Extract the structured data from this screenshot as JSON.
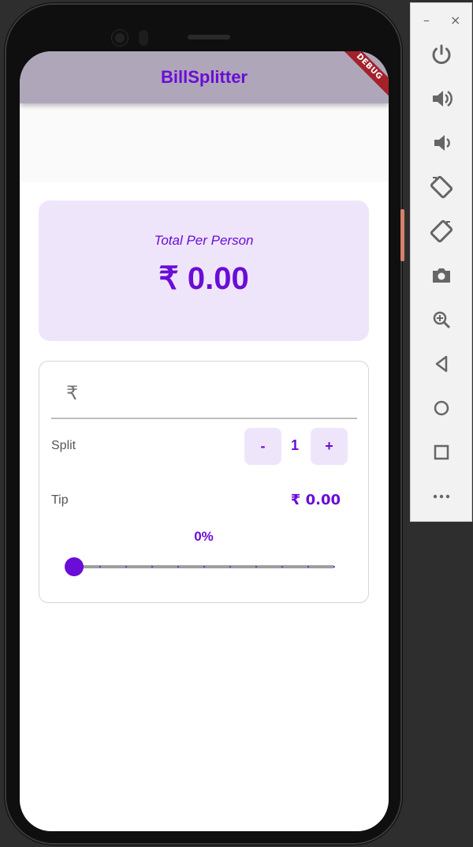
{
  "app": {
    "title": "BillSplitter",
    "debug_banner": "DEBUG"
  },
  "summary": {
    "label": "Total Per Person",
    "amount": "₹ 0.00"
  },
  "bill_input": {
    "prefix": "₹",
    "value": ""
  },
  "split": {
    "label": "Split",
    "decrement_label": "-",
    "count": "1",
    "increment_label": "+"
  },
  "tip": {
    "label": "Tip",
    "amount": "₹ 0.00",
    "percent_label": "0%",
    "percent_value": 0,
    "tick_count": 11
  },
  "emulator_toolbar": {
    "minimize": "–",
    "close": "×",
    "buttons": [
      "power-icon",
      "volume-up-icon",
      "volume-down-icon",
      "rotate-left-icon",
      "rotate-right-icon",
      "camera-icon",
      "zoom-icon",
      "back-icon",
      "home-icon",
      "overview-icon",
      "more-icon"
    ]
  },
  "colors": {
    "accent": "#6a0dd6",
    "appbar": "#b0a6b9",
    "card": "#efe5fb",
    "debug": "#a3212b"
  }
}
